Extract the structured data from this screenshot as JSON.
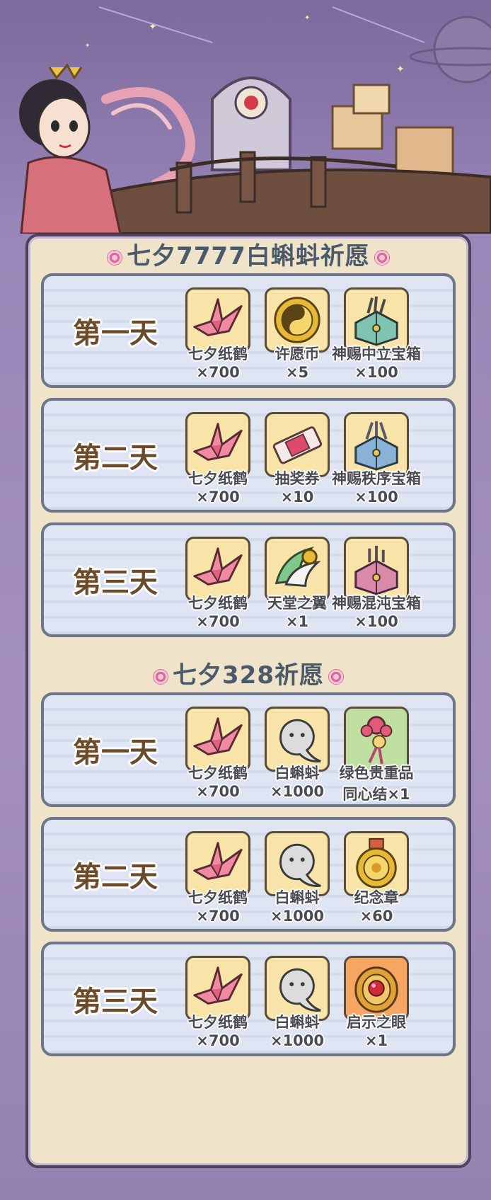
{
  "sections": [
    {
      "title": "七夕7777白蝌蚪祈愿",
      "days": [
        {
          "label": "第一天",
          "items": [
            {
              "icon": "paper-crane-icon",
              "name": "七夕纸鹤",
              "qty": "×700"
            },
            {
              "icon": "wish-coin-icon",
              "name": "许愿币",
              "qty": "×5"
            },
            {
              "icon": "neutral-chest-icon",
              "name": "神赐中立宝箱",
              "qty": "×100"
            }
          ]
        },
        {
          "label": "第二天",
          "items": [
            {
              "icon": "paper-crane-icon",
              "name": "七夕纸鹤",
              "qty": "×700"
            },
            {
              "icon": "lottery-ticket-icon",
              "name": "抽奖券",
              "qty": "×10"
            },
            {
              "icon": "order-chest-icon",
              "name": "神赐秩序宝箱",
              "qty": "×100"
            }
          ]
        },
        {
          "label": "第三天",
          "items": [
            {
              "icon": "paper-crane-icon",
              "name": "七夕纸鹤",
              "qty": "×700"
            },
            {
              "icon": "heaven-wings-icon",
              "name": "天堂之翼",
              "qty": "×1"
            },
            {
              "icon": "chaos-chest-icon",
              "name": "神赐混沌宝箱",
              "qty": "×100"
            }
          ]
        }
      ]
    },
    {
      "title": "七夕328祈愿",
      "days": [
        {
          "label": "第一天",
          "items": [
            {
              "icon": "paper-crane-icon",
              "name": "七夕纸鹤",
              "qty": "×700"
            },
            {
              "icon": "white-tadpole-icon",
              "name": "白蝌蚪",
              "qty": "×1000"
            },
            {
              "icon": "love-knot-icon",
              "name": "绿色贵重品",
              "qty": "同心结×1"
            }
          ]
        },
        {
          "label": "第二天",
          "items": [
            {
              "icon": "paper-crane-icon",
              "name": "七夕纸鹤",
              "qty": "×700"
            },
            {
              "icon": "white-tadpole-icon",
              "name": "白蝌蚪",
              "qty": "×1000"
            },
            {
              "icon": "medal-icon",
              "name": "纪念章",
              "qty": "×60"
            }
          ]
        },
        {
          "label": "第三天",
          "items": [
            {
              "icon": "paper-crane-icon",
              "name": "七夕纸鹤",
              "qty": "×700"
            },
            {
              "icon": "white-tadpole-icon",
              "name": "白蝌蚪",
              "qty": "×1000"
            },
            {
              "icon": "revelation-eye-icon",
              "name": "启示之眼",
              "qty": "×1"
            }
          ]
        }
      ]
    }
  ],
  "colors": {
    "panel": "#efe3c9",
    "title": "#4b5a6a",
    "dayLabel": "#6b4b2a",
    "tileDefault": "#f8e3a8",
    "tileGreen": "#bfe0a0",
    "tileOrange": "#f6a662"
  }
}
